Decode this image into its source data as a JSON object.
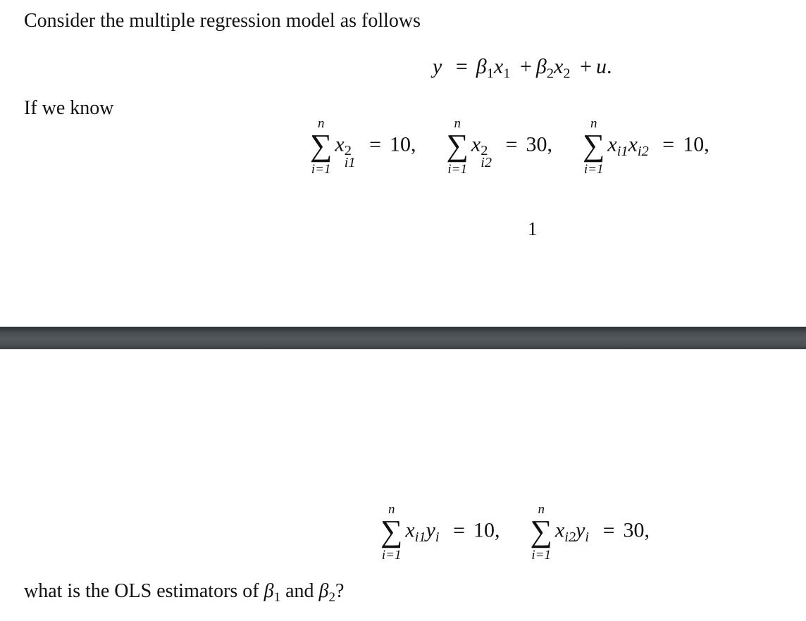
{
  "page1": {
    "intro": "Consider the multiple regression model as follows",
    "model": {
      "lhs": "y",
      "beta1": "β",
      "beta1_sub": "1",
      "x1": "x",
      "x1_sub": "1",
      "plus1": "+",
      "beta2": "β",
      "beta2_sub": "2",
      "x2": "x",
      "x2_sub": "2",
      "plus2": "+",
      "u": "u",
      "end": ".",
      "eq": "="
    },
    "if_text": "If we know",
    "sums": [
      {
        "top": "n",
        "bottom": "i=1",
        "var": "x",
        "sup": "2",
        "sub": "i1",
        "value": "10,"
      },
      {
        "top": "n",
        "bottom": "i=1",
        "var": "x",
        "sup": "2",
        "sub": "i2",
        "value": "30,"
      },
      {
        "top": "n",
        "bottom": "i=1",
        "var1": "x",
        "sub1": "i1",
        "var2": "x",
        "sub2": "i2",
        "value": "10,"
      }
    ],
    "page_number": "1"
  },
  "page2": {
    "sums": [
      {
        "top": "n",
        "bottom": "i=1",
        "var1": "x",
        "sub1": "i1",
        "var2": "y",
        "sub2": "i",
        "value": "10,"
      },
      {
        "top": "n",
        "bottom": "i=1",
        "var1": "x",
        "sub1": "i2",
        "var2": "y",
        "sub2": "i",
        "value": "30,"
      }
    ],
    "question": {
      "prefix": "what is the OLS estimators of",
      "b1": "β",
      "b1_sub": "1",
      "and": "and",
      "b2": "β",
      "b2_sub": "2",
      "end": "?"
    }
  },
  "symbols": {
    "sigma": "∑",
    "eq": "="
  }
}
